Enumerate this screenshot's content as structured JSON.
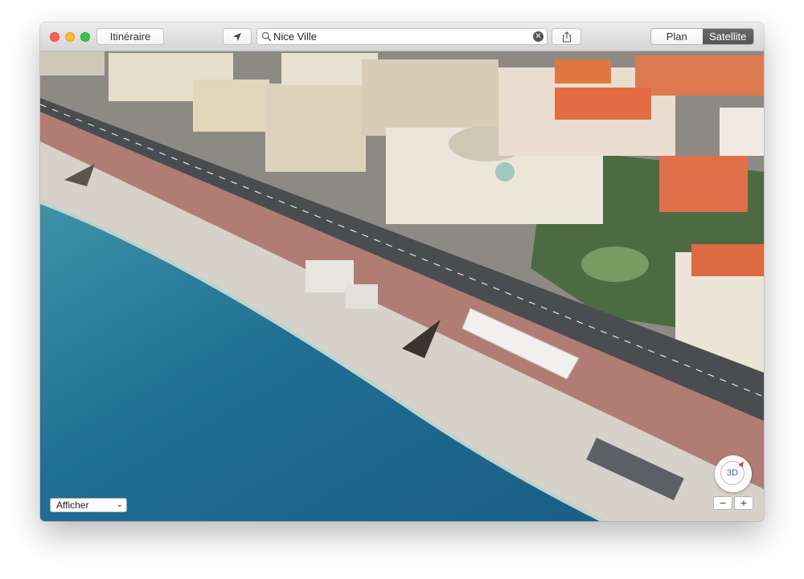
{
  "toolbar": {
    "route_label": "Itinéraire",
    "location_icon": "location-arrow-icon",
    "search": {
      "value": "Nice Ville",
      "icon": "magnifier-icon",
      "clear_icon": "clear-icon",
      "clear_glyph": "✕"
    },
    "share_icon": "share-icon",
    "view_modes": {
      "plan": "Plan",
      "satellite": "Satellite",
      "selected": "satellite"
    }
  },
  "map": {
    "show_menu": {
      "label": "Afficher",
      "chevron": "⌄"
    },
    "compass": {
      "label": "3D"
    },
    "zoom": {
      "out": "−",
      "in": "+"
    }
  },
  "colors": {
    "sea": "#1e6f93",
    "shallow": "#5fa8b5",
    "beach": "#d6d2c9",
    "promenade": "#b07c74",
    "road": "#4a4d50",
    "roof": "#e0704a",
    "greenery": "#3f6b3c",
    "satellite_selected": "#5e5e5e"
  }
}
